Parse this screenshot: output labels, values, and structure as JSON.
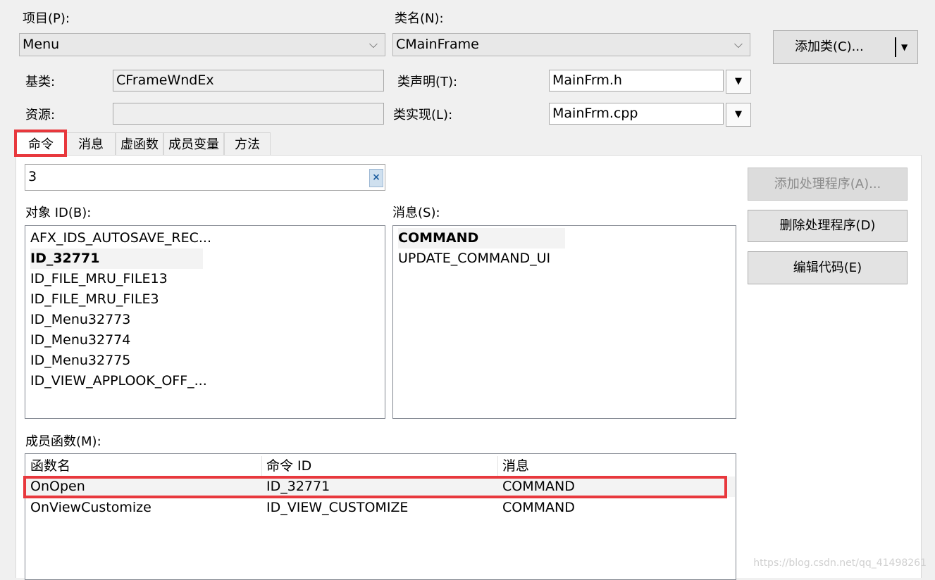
{
  "project": {
    "label": "项目(P):",
    "value": "Menu"
  },
  "classname": {
    "label": "类名(N):",
    "value": "CMainFrame"
  },
  "add_class_button": {
    "label": "添加类(C)..."
  },
  "base_class": {
    "label": "基类:",
    "value": "CFrameWndEx"
  },
  "resource": {
    "label": "资源:",
    "value": ""
  },
  "class_decl": {
    "label": "类声明(T):",
    "value": "MainFrm.h"
  },
  "class_impl": {
    "label": "类实现(L):",
    "value": "MainFrm.cpp"
  },
  "tabs": [
    {
      "label": "命令",
      "active": true
    },
    {
      "label": "消息"
    },
    {
      "label": "虚函数"
    },
    {
      "label": "成员变量"
    },
    {
      "label": "方法"
    }
  ],
  "search": {
    "value": "3"
  },
  "object_ids": {
    "label": "对象 ID(B):",
    "items": [
      "AFX_IDS_AUTOSAVE_REC...",
      "ID_32771",
      "ID_FILE_MRU_FILE13",
      "ID_FILE_MRU_FILE3",
      "ID_Menu32773",
      "ID_Menu32774",
      "ID_Menu32775",
      "ID_VIEW_APPLOOK_OFF_..."
    ],
    "selected_index": 1
  },
  "messages": {
    "label": "消息(S):",
    "items": [
      "COMMAND",
      "UPDATE_COMMAND_UI"
    ],
    "selected_index": 0
  },
  "buttons": {
    "add_handler": "添加处理程序(A)...",
    "delete_handler": "删除处理程序(D)",
    "edit_code": "编辑代码(E)"
  },
  "member_functions": {
    "label": "成员函数(M):",
    "columns": [
      "函数名",
      "命令 ID",
      "消息"
    ],
    "rows": [
      [
        "OnOpen",
        "ID_32771",
        "COMMAND"
      ],
      [
        "OnViewCustomize",
        "ID_VIEW_CUSTOMIZE",
        "COMMAND"
      ]
    ]
  },
  "watermark": "https://blog.csdn.net/qq_41498261",
  "colors": {
    "highlight_red": "#e8383d",
    "background": "#f0f0f0"
  }
}
